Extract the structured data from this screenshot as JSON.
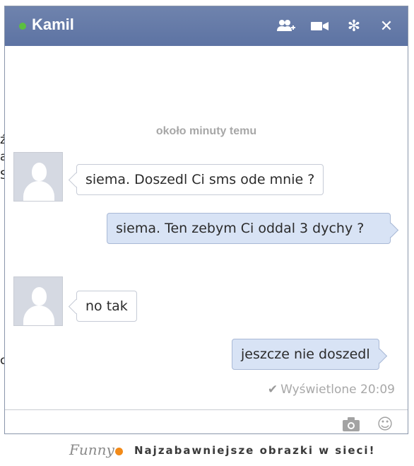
{
  "background_page": {
    "edge_text": [
      "ź",
      "a",
      "Si",
      "c"
    ]
  },
  "chat": {
    "contact_name": "Kamil",
    "status_color": "#5bbf3f",
    "titlebar_color": "#6b7fa9",
    "icons": {
      "add_friends": "add-friends-icon",
      "video_call": "video-camera-icon",
      "settings": "gear-icon",
      "close": "close-icon"
    },
    "timestamp": "około minuty temu",
    "messages": [
      {
        "direction": "incoming",
        "text": "siema. Doszedl Ci sms ode mnie ?"
      },
      {
        "direction": "outgoing",
        "text": "siema. Ten zebym Ci oddal 3 dychy ?"
      },
      {
        "direction": "incoming",
        "text": "no tak"
      },
      {
        "direction": "outgoing",
        "text": "jeszcze nie doszedl"
      }
    ],
    "seen_status": "Wyświetlone 20:09",
    "composer": {
      "value": "",
      "camera_icon": "camera-icon",
      "emoji_icon": "emoji-icon"
    }
  },
  "footer": {
    "logo_text": "Funny",
    "tagline": "Najzabawniejsze obrazki w sieci!"
  }
}
